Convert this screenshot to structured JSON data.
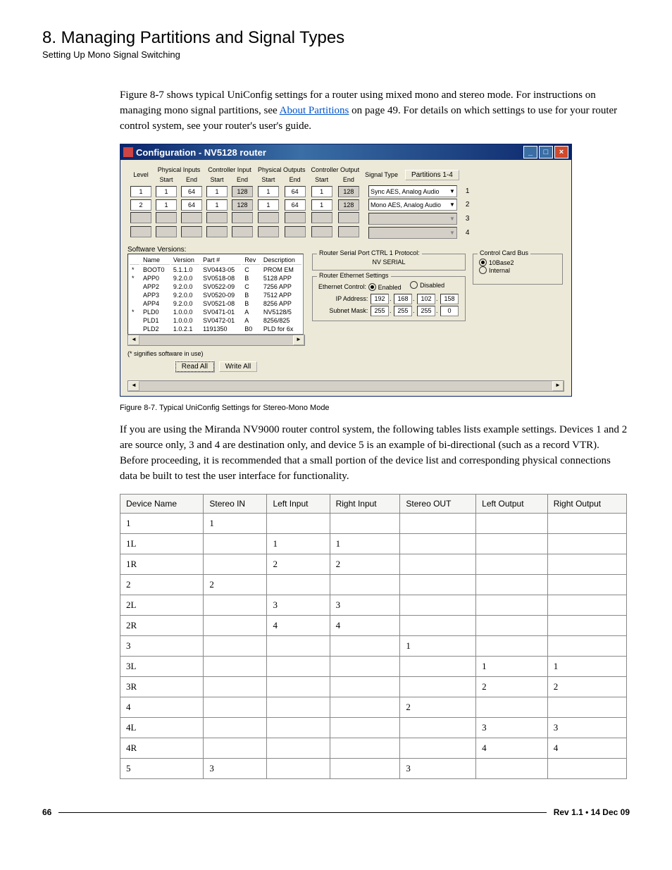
{
  "heading": "8. Managing Partitions and Signal Types",
  "subheading": "Setting Up Mono Signal Switching",
  "para1a": "Figure 8-7 shows typical UniConfig settings for a router using mixed mono and stereo mode. For instructions on managing mono signal partitions, see ",
  "para1_link": "About Partitions",
  "para1b": " on page 49. For details on which settings to use for your router control system, see your router's user's guide.",
  "window_title": "Configuration - NV5128 router",
  "partitions_button": "Partitions 1-4",
  "hdr": {
    "level": "Level",
    "phys_in": "Physical Inputs",
    "ctrl_in": "Controller Input",
    "phys_out": "Physical Outputs",
    "ctrl_out": "Controller Output",
    "start": "Start",
    "end": "End",
    "sigtype": "Signal Type"
  },
  "rows": [
    {
      "level": "1",
      "pis": "1",
      "pie": "64",
      "cis": "1",
      "cie": "128",
      "pos": "1",
      "poe": "64",
      "cos": "1",
      "coe": "128",
      "sig": "Sync AES, Analog Audio",
      "n": "1"
    },
    {
      "level": "2",
      "pis": "1",
      "pie": "64",
      "cis": "1",
      "cie": "128",
      "pos": "1",
      "poe": "64",
      "cos": "1",
      "coe": "128",
      "sig": "Mono AES, Analog Audio",
      "n": "2"
    },
    {
      "level": "",
      "pis": "",
      "pie": "",
      "cis": "",
      "cie": "",
      "pos": "",
      "poe": "",
      "cos": "",
      "coe": "",
      "sig": "",
      "n": "3"
    },
    {
      "level": "",
      "pis": "",
      "pie": "",
      "cis": "",
      "cie": "",
      "pos": "",
      "poe": "",
      "cos": "",
      "coe": "",
      "sig": "",
      "n": "4"
    }
  ],
  "sv_title": "Software Versions:",
  "sv_headers": [
    "Name",
    "Version",
    "Part #",
    "Rev",
    "Description"
  ],
  "sv_rows": [
    [
      "*",
      "BOOT0",
      "5.1.1.0",
      "SV0443-05",
      "C",
      "PROM EM"
    ],
    [
      "*",
      "APP0",
      "9.2.0.0",
      "SV0518-08",
      "B",
      "5128 APP"
    ],
    [
      "",
      "APP2",
      "9.2.0.0",
      "SV0522-09",
      "C",
      "7256 APP"
    ],
    [
      "",
      "APP3",
      "9.2.0.0",
      "SV0520-09",
      "B",
      "7512 APP"
    ],
    [
      "",
      "APP4",
      "9.2.0.0",
      "SV0521-08",
      "B",
      "8256 APP"
    ],
    [
      "*",
      "PLD0",
      "1.0.0.0",
      "SV0471-01",
      "A",
      "NV5128/5"
    ],
    [
      "",
      "PLD1",
      "1.0.0.0",
      "SV0472-01",
      "A",
      "8256/825"
    ],
    [
      "",
      "PLD2",
      "1.0.2.1",
      "1191350",
      "B0",
      "PLD for 6x"
    ]
  ],
  "sv_note": "(* signifies software in use)",
  "btn_read": "Read All",
  "btn_write": "Write All",
  "serial_legend": "Router Serial Port CTRL 1 Protocol:",
  "serial_value": "NV SERIAL",
  "eth_legend": "Router Ethernet Settings",
  "eth_ctrl_label": "Ethernet Control:",
  "eth_enabled": "Enabled",
  "eth_disabled": "Disabled",
  "ip_label": "IP Address:",
  "ip": [
    "192",
    "168",
    "102",
    "158"
  ],
  "mask_label": "Subnet Mask:",
  "mask": [
    "255",
    "255",
    "255",
    "0"
  ],
  "ccb_legend": "Control Card Bus",
  "ccb_a": "10Base2",
  "ccb_b": "Internal",
  "caption": "Figure 8-7. Typical UniConfig Settings for Stereo-Mono Mode",
  "para2": "If you are using the Miranda NV9000 router control system, the following tables lists example settings. Devices 1 and 2 are source only, 3 and 4 are destination only, and device 5 is an example of bi-directional (such as a record VTR). Before proceeding, it is recommended that a small portion of the device list and corresponding physical connections data be built to test the user interface for functionality.",
  "dev_headers": [
    "Device Name",
    "Stereo IN",
    "Left Input",
    "Right Input",
    "Stereo OUT",
    "Left Output",
    "Right Output"
  ],
  "dev_rows": [
    [
      "1",
      "1",
      "",
      "",
      "",
      "",
      ""
    ],
    [
      "1L",
      "",
      "1",
      "1",
      "",
      "",
      ""
    ],
    [
      "1R",
      "",
      "2",
      "2",
      "",
      "",
      ""
    ],
    [
      "2",
      "2",
      "",
      "",
      "",
      "",
      ""
    ],
    [
      "2L",
      "",
      "3",
      "3",
      "",
      "",
      ""
    ],
    [
      "2R",
      "",
      "4",
      "4",
      "",
      "",
      ""
    ],
    [
      "3",
      "",
      "",
      "",
      "1",
      "",
      ""
    ],
    [
      "3L",
      "",
      "",
      "",
      "",
      "1",
      "1"
    ],
    [
      "3R",
      "",
      "",
      "",
      "",
      "2",
      "2"
    ],
    [
      "4",
      "",
      "",
      "",
      "2",
      "",
      ""
    ],
    [
      "4L",
      "",
      "",
      "",
      "",
      "3",
      "3"
    ],
    [
      "4R",
      "",
      "",
      "",
      "",
      "4",
      "4"
    ],
    [
      "5",
      "3",
      "",
      "",
      "3",
      "",
      ""
    ]
  ],
  "footer_page": "66",
  "footer_rev": "Rev 1.1 • 14 Dec 09"
}
